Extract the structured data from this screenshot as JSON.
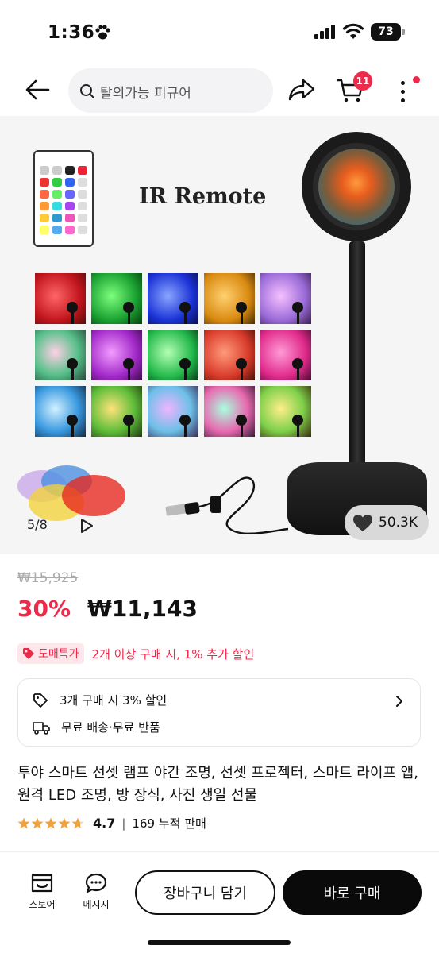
{
  "status_bar": {
    "time": "1:36",
    "battery": "73"
  },
  "nav": {
    "search_placeholder": "탈의가능 피규어",
    "cart_count": "11"
  },
  "gallery": {
    "ir_label": "IR Remote",
    "counter": "5/8",
    "likes": "50.3K"
  },
  "price": {
    "original": "₩15,925",
    "discount": "30%",
    "current": "₩11,143"
  },
  "promo": {
    "tag": "도매특가",
    "text": "2개 이상 구매 시, 1% 추가 할인"
  },
  "benefits": {
    "bulk": "3개 구매 시 3% 할인",
    "shipping": "무료 배송·무료 반품"
  },
  "product": {
    "title": "투야 스마트 선셋 램프 야간 조명, 선셋 프로젝터, 스마트 라이프 앱, 원격 LED 조명, 방 장식, 사진 생일 선물",
    "rating": "4.7",
    "sold": "169 누적 판매"
  },
  "bottom_bar": {
    "store": "스토어",
    "messages": "메시지",
    "add_to_cart": "장바구니 담기",
    "buy_now": "바로 구매"
  },
  "colors": {
    "accent": "#ee2a4a",
    "primary_button": "#0a0a0a"
  }
}
